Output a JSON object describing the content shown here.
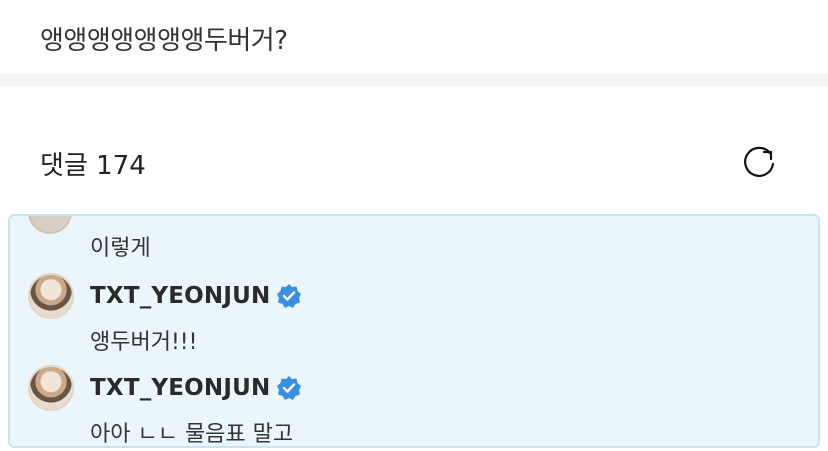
{
  "post": {
    "title": "앵앵앵앵앵앵앵두버거?"
  },
  "comments": {
    "header": "댓글 174",
    "refresh_icon": "refresh-icon",
    "thread": {
      "first_reply_text": "이렇게",
      "replies": [
        {
          "author": "TXT_YEONJUN",
          "verified": true,
          "text": "앵두버거!!!"
        },
        {
          "author": "TXT_YEONJUN",
          "verified": true,
          "text": "아아 ㄴㄴ 물음표 말고"
        }
      ]
    }
  },
  "colors": {
    "highlight_bg": "#eaf6fc",
    "highlight_border": "#c9e4f0",
    "verified_blue": "#3b8fe0"
  }
}
